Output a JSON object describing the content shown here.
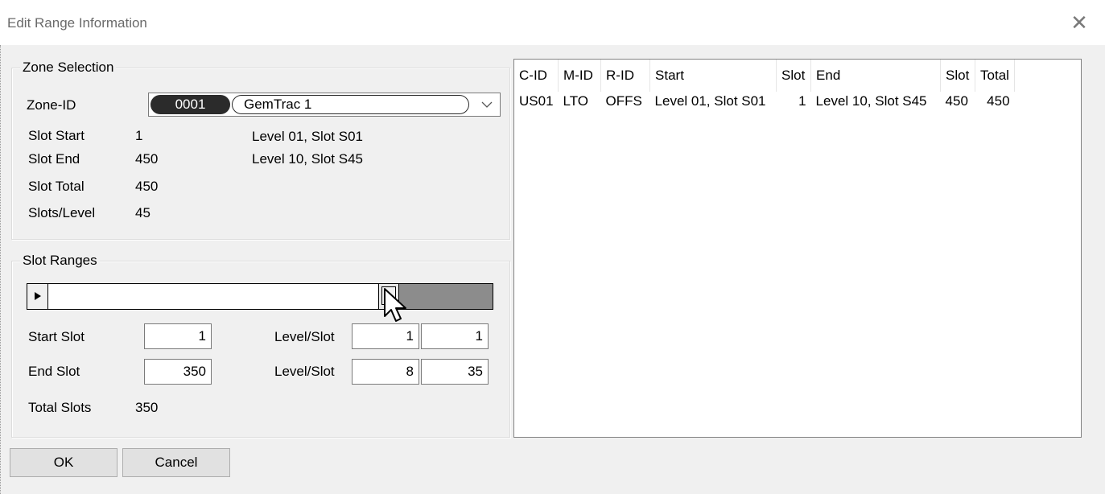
{
  "window": {
    "title": "Edit Range Information",
    "close_glyph": "✕"
  },
  "zone_selection": {
    "legend": "Zone Selection",
    "zone_id_label": "Zone-ID",
    "zone_id_value": "0001",
    "zone_name": "GemTrac 1",
    "slot_start_label": "Slot Start",
    "slot_start_value": "1",
    "slot_start_location": "Level 01, Slot S01",
    "slot_end_label": "Slot End",
    "slot_end_value": "450",
    "slot_end_location": "Level 10, Slot S45",
    "slot_total_label": "Slot Total",
    "slot_total_value": "450",
    "slots_per_level_label": "Slots/Level",
    "slots_per_level_value": "45"
  },
  "slot_ranges": {
    "legend": "Slot Ranges",
    "slider_fraction": 0.778,
    "start_slot_label": "Start Slot",
    "start_slot_value": "1",
    "start_level_slot_label": "Level/Slot",
    "start_level_value": "1",
    "start_slot_in_level_value": "1",
    "end_slot_label": "End Slot",
    "end_slot_value": "350",
    "end_level_slot_label": "Level/Slot",
    "end_level_value": "8",
    "end_slot_in_level_value": "35",
    "total_slots_label": "Total Slots",
    "total_slots_value": "350"
  },
  "table": {
    "columns": [
      "C-ID",
      "M-ID",
      "R-ID",
      "Start",
      "Slot",
      "End",
      "Slot",
      "Total"
    ],
    "rows": [
      [
        "US01",
        "LTO",
        "OFFS",
        "Level 01, Slot S01",
        "1",
        "Level 10, Slot S45",
        "450",
        "450"
      ]
    ]
  },
  "buttons": {
    "ok_label": "OK",
    "cancel_label": "Cancel"
  },
  "colors": {
    "slider_remaining": "#8c8c8c",
    "zone_pill": "#2b2b2b",
    "client_bg": "#f0f0f0"
  }
}
